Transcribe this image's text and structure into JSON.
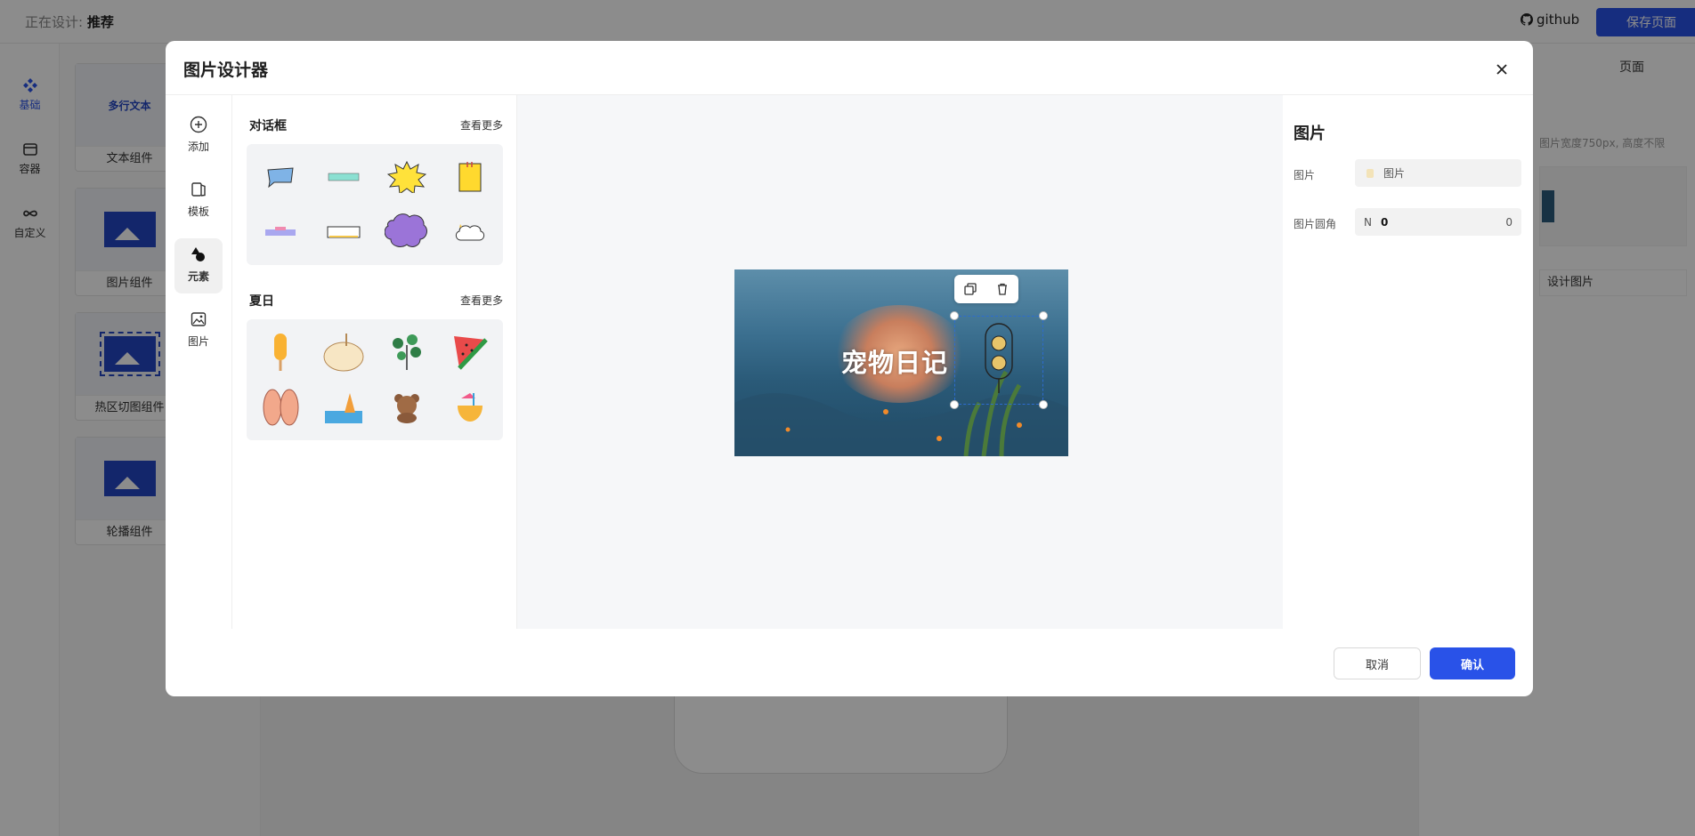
{
  "app": {
    "designing_prefix": "正在设计:",
    "designing_page": "推荐",
    "github_label": "github",
    "save_label": "保存页面"
  },
  "leftnav": {
    "items": [
      {
        "label": "基础",
        "icon": "components-icon",
        "active": true
      },
      {
        "label": "容器",
        "icon": "container-icon"
      },
      {
        "label": "自定义",
        "icon": "infinity-icon"
      }
    ]
  },
  "components": [
    {
      "label": "文本组件",
      "thumb": "多行文本"
    },
    {
      "label": "图片组件"
    },
    {
      "label": "热区切图组件"
    },
    {
      "label": "轮播组件"
    }
  ],
  "right_panel": {
    "tab": "页面",
    "hint": "图片宽度750px, 高度不限",
    "design_button": "设计图片"
  },
  "modal": {
    "title": "图片设计器",
    "tools": [
      {
        "label": "添加",
        "icon": "plus-circle-icon"
      },
      {
        "label": "模板",
        "icon": "template-icon"
      },
      {
        "label": "元素",
        "icon": "shapes-icon",
        "active": true
      },
      {
        "label": "图片",
        "icon": "image-icon"
      }
    ],
    "sections": [
      {
        "title": "对话框",
        "more": "查看更多"
      },
      {
        "title": "夏日",
        "more": "查看更多"
      }
    ],
    "canvas_text": "宠物日记",
    "props": {
      "title": "图片",
      "image_label": "图片",
      "image_value": "图片",
      "radius_label": "图片圆角",
      "radius_prefix": "N",
      "radius_value": "0",
      "radius_suffix": "0"
    },
    "cancel_label": "取消",
    "confirm_label": "确认"
  },
  "colors": {
    "accent": "#2952e8",
    "overlay": "rgba(0,0,0,0.45)",
    "selection": "#2d6ccf"
  }
}
